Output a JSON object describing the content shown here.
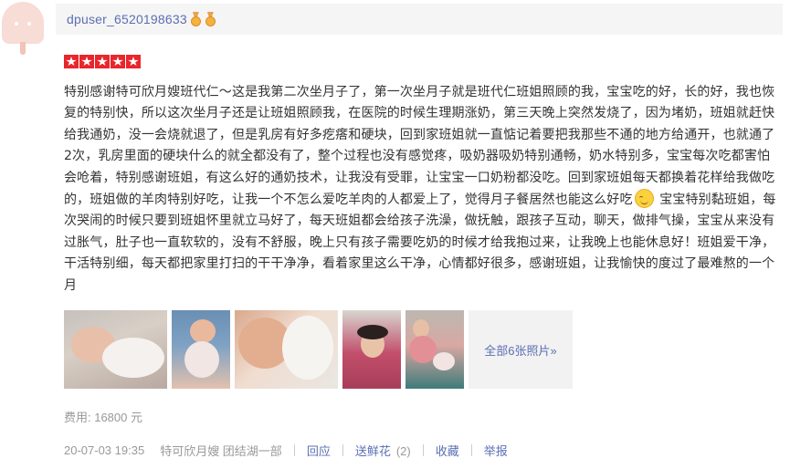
{
  "user": {
    "name": "dpuser_6520198633",
    "medals": [
      "medal-icon",
      "medal-icon"
    ]
  },
  "rating": {
    "stars": 5,
    "max": 5
  },
  "review": {
    "text_before_emoji": "特别感谢特可欣月嫂班代仁～这是我第二次坐月子了，第一次坐月子就是班代仁班姐照顾的我，宝宝吃的好，长的好，我也恢复的特别快，所以这次坐月子还是让班姐照顾我，在医院的时候生理期涨奶，第三天晚上突然发烧了，因为堵奶，班姐就赶快给我通奶，没一会烧就退了，但是乳房有好多疙瘩和硬块，回到家班姐就一直惦记着要把我那些不通的地方给通开，也就通了2次，乳房里面的硬块什么的就全都没有了，整个过程也没有感觉疼，吸奶器吸奶特别通畅，奶水特别多，宝宝每次吃都害怕会呛着，特别感谢班姐，有这么好的通奶技术，让我没有受罪，让宝宝一口奶粉都没吃。回到家班姐每天都换着花样给我做吃的，班姐做的羊肉特别好吃，让我一个不怎么爱吃羊肉的人都爱上了，觉得月子餐居然也能这么好吃",
    "emoji": "smile-emoji",
    "text_after_emoji": " 宝宝特别黏班姐，每次哭闹的时候只要到班姐怀里就立马好了，每天班姐都会给孩子洗澡，做抚触，跟孩子互动，聊天，做排气操，宝宝从来没有过胀气，肚子也一直软软的，没有不舒服，晚上只有孩子需要吃奶的时候才给我抱过来，让我晚上也能休息好！班姐爱干净，干活特别细，每天都把家里打扫的干干净净，看着家里这么干净，心情都好很多，感谢班姐，让我愉快的度过了最难熬的一个月"
  },
  "photos": {
    "thumbnails": [
      "baby-sleeping-photo",
      "baby-on-blanket-photo",
      "newborn-closeup-photo",
      "mother-portrait-photo",
      "nanny-with-baby-photo"
    ],
    "more_label": "全部6张照片»"
  },
  "fee": {
    "label": "费用: 16800 元"
  },
  "footer": {
    "date": "20-07-03 19:35",
    "shop": "特可欣月嫂 团结湖一部",
    "reply": "回应",
    "flower": "送鲜花",
    "flower_count": "(2)",
    "favorite": "收藏",
    "report": "举报"
  },
  "colors": {
    "link": "#5b6fb3",
    "star": "#e8262b",
    "muted": "#999999",
    "user_bar_bg": "#f5f5f5"
  }
}
